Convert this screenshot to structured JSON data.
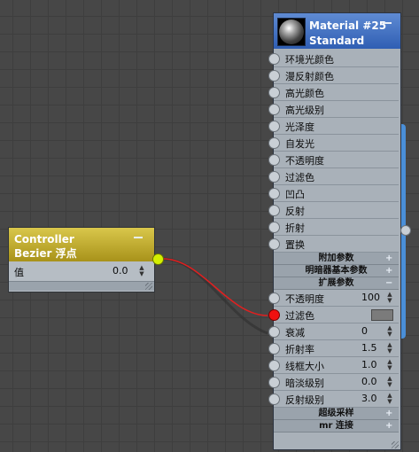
{
  "material_node": {
    "title": "Material #25",
    "type": "Standard",
    "slots": [
      {
        "label": "环境光颜色"
      },
      {
        "label": "漫反射颜色"
      },
      {
        "label": "高光颜色"
      },
      {
        "label": "高光级别"
      },
      {
        "label": "光泽度"
      },
      {
        "label": "自发光"
      },
      {
        "label": "不透明度"
      },
      {
        "label": "过滤色"
      },
      {
        "label": "凹凸"
      },
      {
        "label": "反射"
      },
      {
        "label": "折射"
      },
      {
        "label": "置换"
      }
    ],
    "rollouts_top": [
      {
        "label": "附加参数",
        "toggle": "+"
      },
      {
        "label": "明暗器基本参数",
        "toggle": "+"
      },
      {
        "label": "扩展参数",
        "toggle": "−"
      }
    ],
    "params": [
      {
        "label": "不透明度",
        "value": "100",
        "kind": "number"
      },
      {
        "label": "过滤色",
        "value": "",
        "kind": "color",
        "swatch": "#7b7b7b",
        "connected": true
      },
      {
        "label": "衰减",
        "value": "0",
        "kind": "number"
      },
      {
        "label": "折射率",
        "value": "1.5",
        "kind": "number"
      },
      {
        "label": "线框大小",
        "value": "1.0",
        "kind": "number"
      },
      {
        "label": "暗淡级别",
        "value": "0.0",
        "kind": "number"
      },
      {
        "label": "反射级别",
        "value": "3.0",
        "kind": "number"
      }
    ],
    "rollouts_bottom": [
      {
        "label": "超级采样",
        "toggle": "+"
      },
      {
        "label": "mr 连接",
        "toggle": "+"
      }
    ]
  },
  "controller_node": {
    "title": "Controller",
    "type": "Bezier 浮点",
    "param_label": "值",
    "param_value": "0.0"
  },
  "colors": {
    "material_header": "#2f5eb3",
    "controller_header": "#a8921a",
    "wire": "#e02020",
    "output_socket": "#d4f000",
    "connected_socket": "#f01010"
  }
}
